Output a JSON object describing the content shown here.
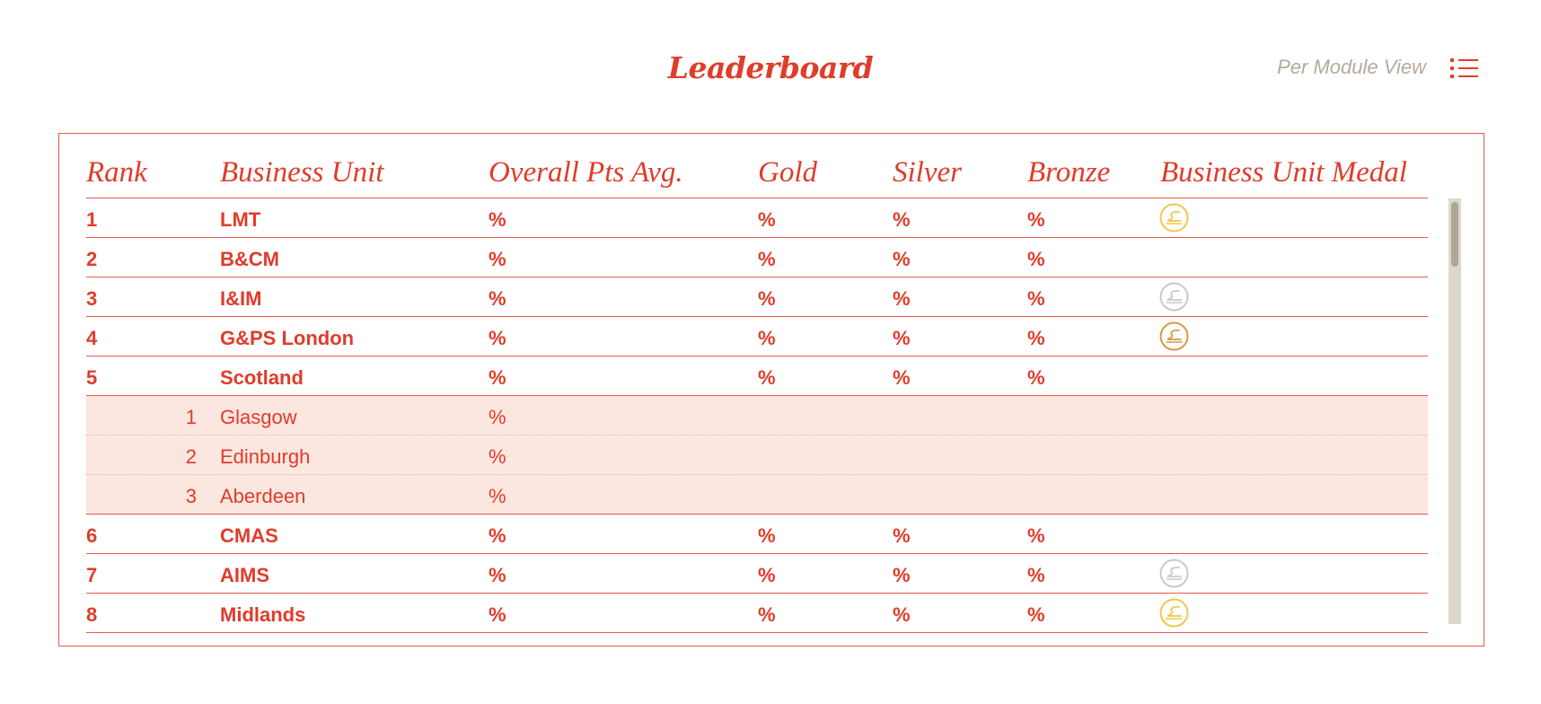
{
  "header": {
    "title": "Leaderboard",
    "view_link": "Per Module View"
  },
  "table": {
    "columns": [
      "Rank",
      "Business Unit",
      "Overall Pts Avg.",
      "Gold",
      "Silver",
      "Bronze",
      "Business Unit Medal"
    ],
    "rows": [
      {
        "rank": "1",
        "unit": "LMT",
        "pts": "%",
        "gold": "%",
        "silver": "%",
        "bronze": "%",
        "medal": "gold"
      },
      {
        "rank": "2",
        "unit": "B&CM",
        "pts": "%",
        "gold": "%",
        "silver": "%",
        "bronze": "%",
        "medal": ""
      },
      {
        "rank": "3",
        "unit": "I&IM",
        "pts": "%",
        "gold": "%",
        "silver": "%",
        "bronze": "%",
        "medal": "silver"
      },
      {
        "rank": "4",
        "unit": "G&PS London",
        "pts": "%",
        "gold": "%",
        "silver": "%",
        "bronze": "%",
        "medal": "bronze"
      },
      {
        "rank": "5",
        "unit": "Scotland",
        "pts": "%",
        "gold": "%",
        "silver": "%",
        "bronze": "%",
        "medal": "",
        "subunits": [
          {
            "rank": "1",
            "unit": "Glasgow",
            "pts": "%"
          },
          {
            "rank": "2",
            "unit": "Edinburgh",
            "pts": "%"
          },
          {
            "rank": "3",
            "unit": "Aberdeen",
            "pts": "%"
          }
        ]
      },
      {
        "rank": "6",
        "unit": "CMAS",
        "pts": "%",
        "gold": "%",
        "silver": "%",
        "bronze": "%",
        "medal": ""
      },
      {
        "rank": "7",
        "unit": "AIMS",
        "pts": "%",
        "gold": "%",
        "silver": "%",
        "bronze": "%",
        "medal": "silver"
      },
      {
        "rank": "8",
        "unit": "Midlands",
        "pts": "%",
        "gold": "%",
        "silver": "%",
        "bronze": "%",
        "medal": "gold"
      }
    ]
  },
  "icons": {
    "view_toggle": "list-icon",
    "medal": "medal-icon"
  },
  "colors": {
    "accent": "#e03c2a",
    "subrow_bg": "#fce6e0",
    "muted": "#b3ab9c",
    "gold": "#f2c84b",
    "silver": "#c9c9c9",
    "bronze": "#d49a4a"
  }
}
